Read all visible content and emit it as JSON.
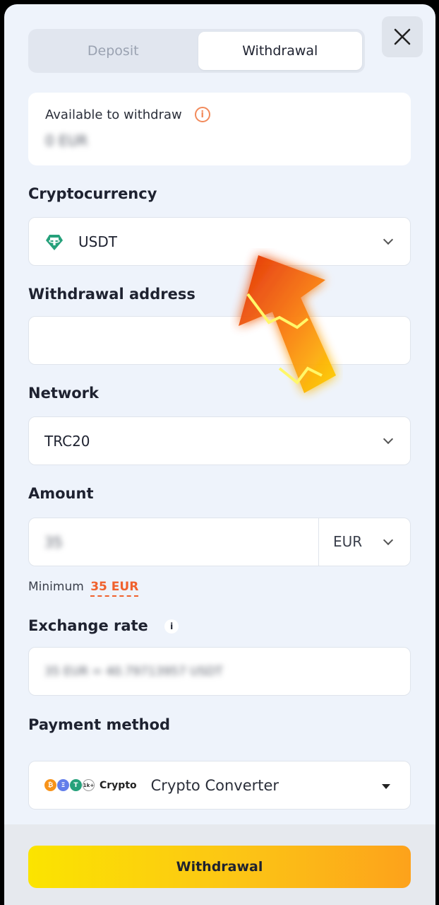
{
  "tabs": [
    {
      "label": "Deposit",
      "active": false
    },
    {
      "label": "Withdrawal",
      "active": true
    }
  ],
  "close_icon": "close-icon",
  "available": {
    "label": "Available to withdraw",
    "value": "0 EUR"
  },
  "cryptocurrency": {
    "label": "Cryptocurrency",
    "value": "USDT",
    "icon": "tether-icon"
  },
  "address": {
    "label": "Withdrawal address",
    "value": ""
  },
  "network": {
    "label": "Network",
    "value": "TRC20"
  },
  "amount": {
    "label": "Amount",
    "value": "35",
    "currency": "EUR"
  },
  "minimum": {
    "label": "Minimum",
    "value": "35 EUR"
  },
  "exchange_rate": {
    "label": "Exchange rate",
    "info_glyph": "i",
    "value": "35 EUR = 40.79713957 USDT"
  },
  "payment_method": {
    "label": "Payment method",
    "brand": "Crypto",
    "value": "Crypto Converter",
    "coins": [
      "₿",
      "Ξ",
      "T",
      "1k+"
    ]
  },
  "submit": {
    "label": "Withdrawal"
  },
  "colors": {
    "accent_orange": "#f0612d",
    "button_gradient_start": "#fbe400",
    "button_gradient_end": "#fda21b"
  }
}
